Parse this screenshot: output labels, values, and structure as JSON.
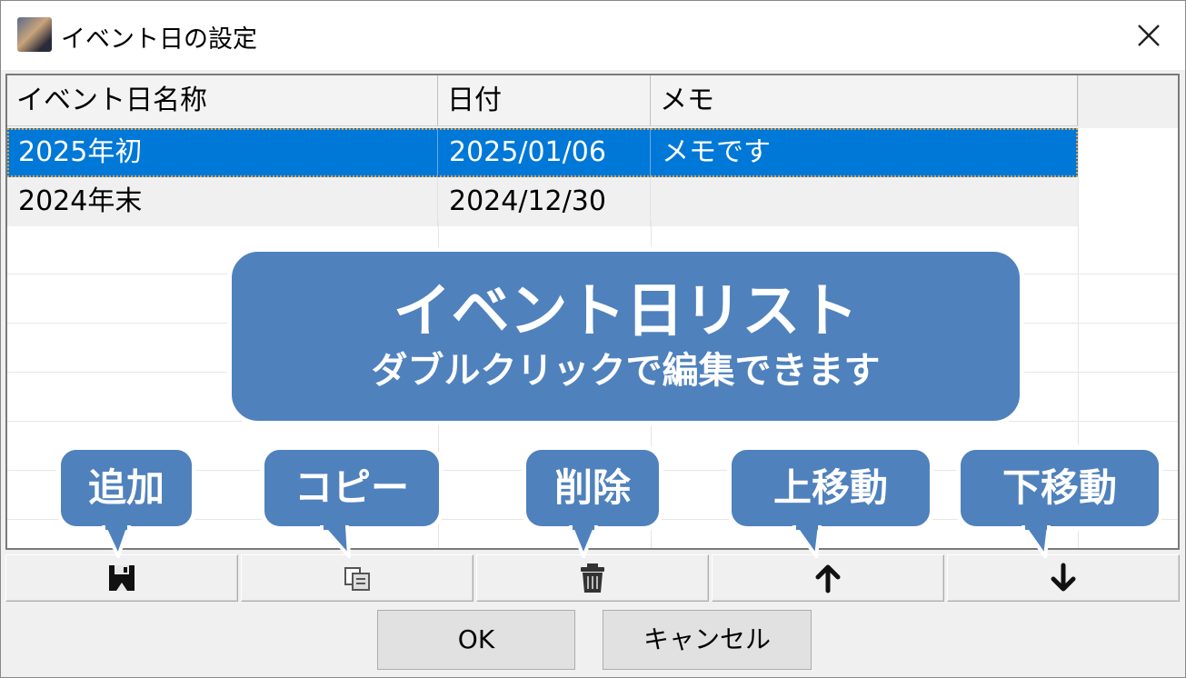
{
  "window": {
    "title": "イベント日の設定",
    "app_icon": "app-icon",
    "close_icon": "close-icon"
  },
  "table": {
    "columns": [
      "イベント日名称",
      "日付",
      "メモ"
    ],
    "rows": [
      {
        "name": "2025年初",
        "date": "2025/01/06",
        "memo": "メモです",
        "selected": true
      },
      {
        "name": "2024年末",
        "date": "2024/12/30",
        "memo": "",
        "selected": false
      }
    ]
  },
  "toolbar": {
    "icons": [
      "save-icon",
      "copy-icon",
      "trash-icon",
      "arrow-up-icon",
      "arrow-down-icon"
    ]
  },
  "buttons": {
    "ok": "OK",
    "cancel": "キャンセル"
  },
  "callouts": {
    "main_title": "イベント日リスト",
    "main_subtitle": "ダブルクリックで編集できます",
    "add": "追加",
    "copy": "コピー",
    "delete": "削除",
    "move_up": "上移動",
    "move_down": "下移動"
  },
  "colors": {
    "selection": "#0078d7",
    "callout": "#4f81bd"
  }
}
